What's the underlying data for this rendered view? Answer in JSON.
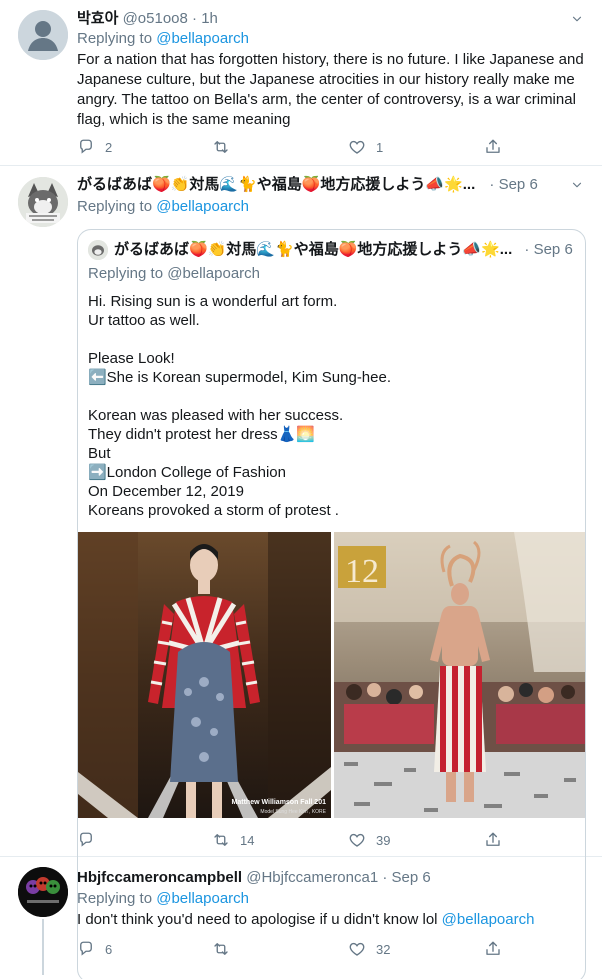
{
  "tweets": [
    {
      "name": "박효아",
      "handle": "@o51oo8",
      "time": "1h",
      "reply_prefix": "Replying to",
      "reply_to": "@bellapoarch",
      "text": "For a nation that has forgotten history, there is no future. I like Japanese and Japanese culture, but the Japanese atrocities in our history really make me angry. The tattoo on Bella's arm, the center of controversy, is a war criminal flag, which is the same meaning",
      "replies": "2",
      "retweets": "",
      "likes": "1"
    },
    {
      "name": "がるばあば🍑👏対馬🌊🐈や福島🍑地方応援しよう📣🌟...",
      "time": "· Sep 6",
      "reply_prefix": "Replying to",
      "reply_to": "@bellapoarch",
      "replies": "",
      "retweets": "14",
      "likes": "39",
      "quote": {
        "name": "がるばあば🍑👏対馬🌊🐈や福島🍑地方応援しよう📣🌟...",
        "time": "· Sep 6",
        "reply_line": "Replying to @bellapoarch",
        "lines": [
          "Hi. Rising sun is a wonderful art form.",
          "Ur tattoo as well.",
          "",
          "Please Look!",
          "⬅️She is Korean supermodel, Kim Sung-hee.",
          "",
          "Korean was pleased with her success.",
          "They didn't protest her dress👗🌅",
          "But",
          "➡️London College of Fashion",
          "On December 12, 2019",
          "Koreans provoked a storm of protest ."
        ],
        "image_left_caption": "Matthew Williamson Fall 201",
        "image_left_sub": "Model  Sung Hee Kim , KORE",
        "image_right_number": "12"
      }
    },
    {
      "name": "Hbjfccameroncampbell",
      "handle": "@Hbjfccameronca1",
      "time": "· Sep 6",
      "reply_prefix": "Replying to",
      "reply_to": "@bellapoarch",
      "text": "I don't think you'd need to apologise if u didn't know lol",
      "text_mention": "@bellapoarch",
      "replies": "6",
      "retweets": "",
      "likes": "32"
    }
  ],
  "colors": {
    "link": "#1b95e0",
    "muted": "#657786",
    "border": "#e6ecf0"
  },
  "icons": [
    "caret-down-icon",
    "reply-icon",
    "retweet-icon",
    "like-icon",
    "share-icon"
  ]
}
